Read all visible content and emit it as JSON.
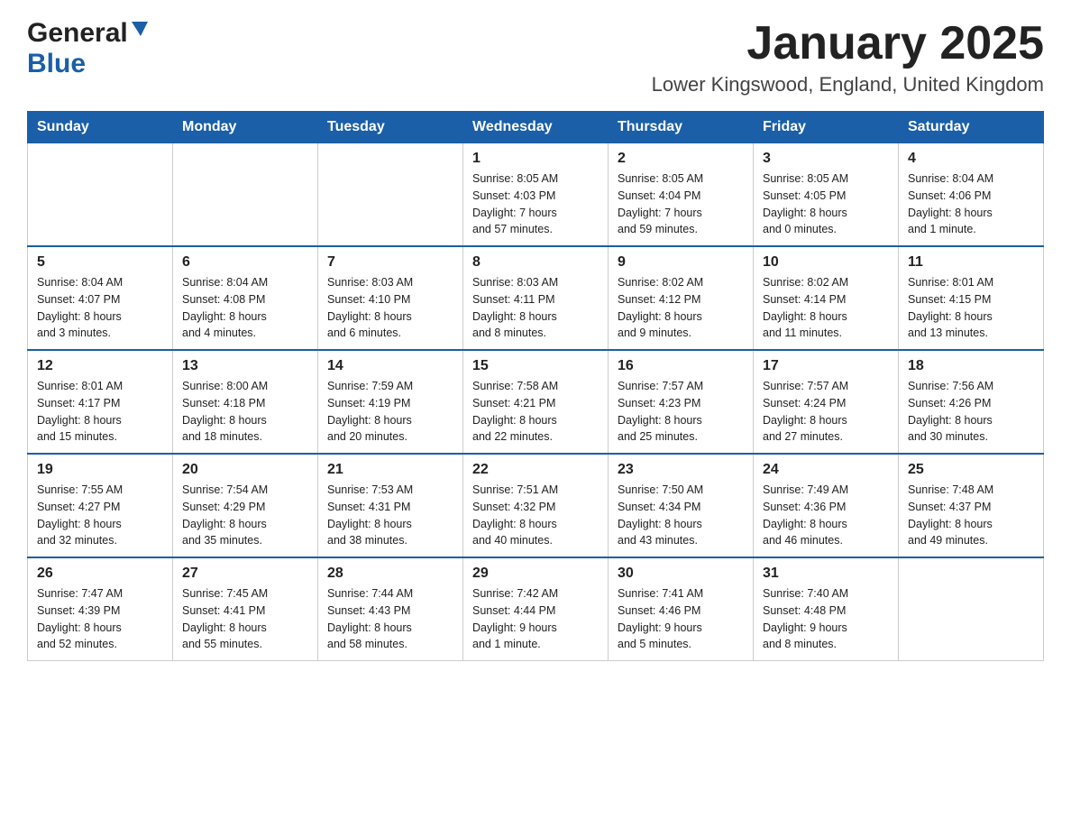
{
  "header": {
    "logo_general": "General",
    "logo_blue": "Blue",
    "month_title": "January 2025",
    "location": "Lower Kingswood, England, United Kingdom"
  },
  "days_of_week": [
    "Sunday",
    "Monday",
    "Tuesday",
    "Wednesday",
    "Thursday",
    "Friday",
    "Saturday"
  ],
  "weeks": [
    [
      {
        "day": "",
        "info": ""
      },
      {
        "day": "",
        "info": ""
      },
      {
        "day": "",
        "info": ""
      },
      {
        "day": "1",
        "info": "Sunrise: 8:05 AM\nSunset: 4:03 PM\nDaylight: 7 hours\nand 57 minutes."
      },
      {
        "day": "2",
        "info": "Sunrise: 8:05 AM\nSunset: 4:04 PM\nDaylight: 7 hours\nand 59 minutes."
      },
      {
        "day": "3",
        "info": "Sunrise: 8:05 AM\nSunset: 4:05 PM\nDaylight: 8 hours\nand 0 minutes."
      },
      {
        "day": "4",
        "info": "Sunrise: 8:04 AM\nSunset: 4:06 PM\nDaylight: 8 hours\nand 1 minute."
      }
    ],
    [
      {
        "day": "5",
        "info": "Sunrise: 8:04 AM\nSunset: 4:07 PM\nDaylight: 8 hours\nand 3 minutes."
      },
      {
        "day": "6",
        "info": "Sunrise: 8:04 AM\nSunset: 4:08 PM\nDaylight: 8 hours\nand 4 minutes."
      },
      {
        "day": "7",
        "info": "Sunrise: 8:03 AM\nSunset: 4:10 PM\nDaylight: 8 hours\nand 6 minutes."
      },
      {
        "day": "8",
        "info": "Sunrise: 8:03 AM\nSunset: 4:11 PM\nDaylight: 8 hours\nand 8 minutes."
      },
      {
        "day": "9",
        "info": "Sunrise: 8:02 AM\nSunset: 4:12 PM\nDaylight: 8 hours\nand 9 minutes."
      },
      {
        "day": "10",
        "info": "Sunrise: 8:02 AM\nSunset: 4:14 PM\nDaylight: 8 hours\nand 11 minutes."
      },
      {
        "day": "11",
        "info": "Sunrise: 8:01 AM\nSunset: 4:15 PM\nDaylight: 8 hours\nand 13 minutes."
      }
    ],
    [
      {
        "day": "12",
        "info": "Sunrise: 8:01 AM\nSunset: 4:17 PM\nDaylight: 8 hours\nand 15 minutes."
      },
      {
        "day": "13",
        "info": "Sunrise: 8:00 AM\nSunset: 4:18 PM\nDaylight: 8 hours\nand 18 minutes."
      },
      {
        "day": "14",
        "info": "Sunrise: 7:59 AM\nSunset: 4:19 PM\nDaylight: 8 hours\nand 20 minutes."
      },
      {
        "day": "15",
        "info": "Sunrise: 7:58 AM\nSunset: 4:21 PM\nDaylight: 8 hours\nand 22 minutes."
      },
      {
        "day": "16",
        "info": "Sunrise: 7:57 AM\nSunset: 4:23 PM\nDaylight: 8 hours\nand 25 minutes."
      },
      {
        "day": "17",
        "info": "Sunrise: 7:57 AM\nSunset: 4:24 PM\nDaylight: 8 hours\nand 27 minutes."
      },
      {
        "day": "18",
        "info": "Sunrise: 7:56 AM\nSunset: 4:26 PM\nDaylight: 8 hours\nand 30 minutes."
      }
    ],
    [
      {
        "day": "19",
        "info": "Sunrise: 7:55 AM\nSunset: 4:27 PM\nDaylight: 8 hours\nand 32 minutes."
      },
      {
        "day": "20",
        "info": "Sunrise: 7:54 AM\nSunset: 4:29 PM\nDaylight: 8 hours\nand 35 minutes."
      },
      {
        "day": "21",
        "info": "Sunrise: 7:53 AM\nSunset: 4:31 PM\nDaylight: 8 hours\nand 38 minutes."
      },
      {
        "day": "22",
        "info": "Sunrise: 7:51 AM\nSunset: 4:32 PM\nDaylight: 8 hours\nand 40 minutes."
      },
      {
        "day": "23",
        "info": "Sunrise: 7:50 AM\nSunset: 4:34 PM\nDaylight: 8 hours\nand 43 minutes."
      },
      {
        "day": "24",
        "info": "Sunrise: 7:49 AM\nSunset: 4:36 PM\nDaylight: 8 hours\nand 46 minutes."
      },
      {
        "day": "25",
        "info": "Sunrise: 7:48 AM\nSunset: 4:37 PM\nDaylight: 8 hours\nand 49 minutes."
      }
    ],
    [
      {
        "day": "26",
        "info": "Sunrise: 7:47 AM\nSunset: 4:39 PM\nDaylight: 8 hours\nand 52 minutes."
      },
      {
        "day": "27",
        "info": "Sunrise: 7:45 AM\nSunset: 4:41 PM\nDaylight: 8 hours\nand 55 minutes."
      },
      {
        "day": "28",
        "info": "Sunrise: 7:44 AM\nSunset: 4:43 PM\nDaylight: 8 hours\nand 58 minutes."
      },
      {
        "day": "29",
        "info": "Sunrise: 7:42 AM\nSunset: 4:44 PM\nDaylight: 9 hours\nand 1 minute."
      },
      {
        "day": "30",
        "info": "Sunrise: 7:41 AM\nSunset: 4:46 PM\nDaylight: 9 hours\nand 5 minutes."
      },
      {
        "day": "31",
        "info": "Sunrise: 7:40 AM\nSunset: 4:48 PM\nDaylight: 9 hours\nand 8 minutes."
      },
      {
        "day": "",
        "info": ""
      }
    ]
  ]
}
